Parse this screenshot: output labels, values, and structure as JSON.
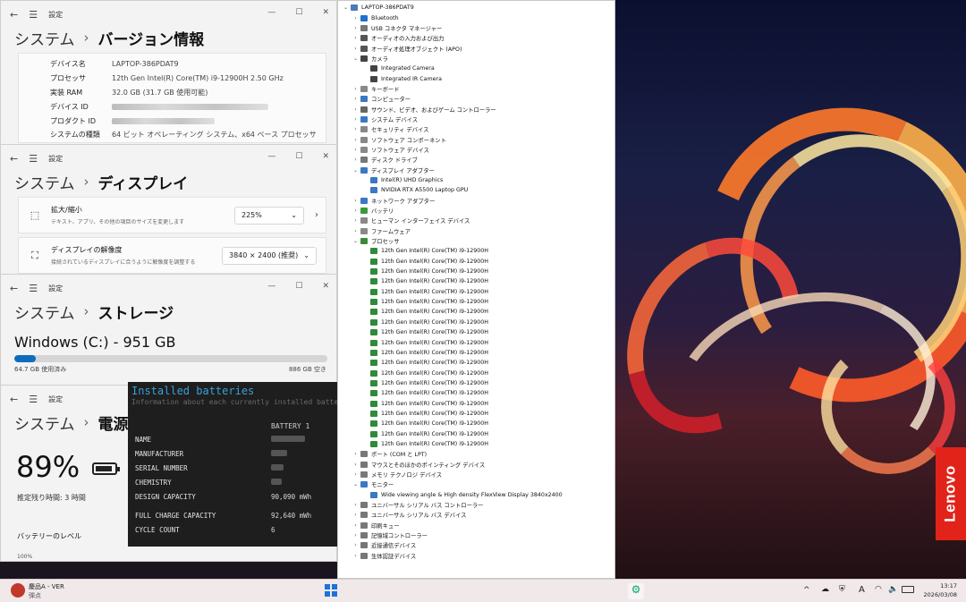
{
  "about": {
    "crumb1": "システム",
    "crumb2": "バージョン情報",
    "title": "設定",
    "rows": [
      {
        "k": "デバイス名",
        "v": "LAPTOP-386PDAT9"
      },
      {
        "k": "プロセッサ",
        "v": "12th Gen Intel(R) Core(TM) i9-12900H   2.50 GHz"
      },
      {
        "k": "実装 RAM",
        "v": "32.0 GB (31.7 GB 使用可能)"
      },
      {
        "k": "デバイス ID",
        "v": ""
      },
      {
        "k": "プロダクト ID",
        "v": ""
      },
      {
        "k": "システムの種類",
        "v": "64 ビット オペレーティング システム、x64 ベース プロセッサ"
      }
    ]
  },
  "display": {
    "crumb1": "システム",
    "crumb2": "ディスプレイ",
    "title": "設定",
    "scale_label": "拡大/縮小",
    "scale_desc": "テキスト、アプリ、その他の項目のサイズを変更します",
    "scale_value": "225%",
    "res_label": "ディスプレイの解像度",
    "res_desc": "接続されているディスプレイに合うように解像度を調整する",
    "res_value": "3840 × 2400 (推奨)"
  },
  "storage": {
    "crumb1": "システム",
    "crumb2": "ストレージ",
    "title": "設定",
    "drive": "Windows (C:) - 951 GB",
    "used": "64.7 GB 使用済み",
    "free": "886 GB 空き",
    "used_fraction": 0.068
  },
  "power": {
    "crumb1": "システム",
    "crumb2": "電源と",
    "title": "設定",
    "percent": "89%",
    "remaining": "推定残り時間: 3 時間",
    "level_label": "バッテリーのレベル",
    "axis_label": "100%"
  },
  "batteries": {
    "title": "Installed batteries",
    "subtitle": "Information about each currently installed battery",
    "column": "BATTERY 1",
    "rows": [
      {
        "k": "NAME",
        "v": ""
      },
      {
        "k": "MANUFACTURER",
        "v": ""
      },
      {
        "k": "SERIAL NUMBER",
        "v": ""
      },
      {
        "k": "CHEMISTRY",
        "v": ""
      },
      {
        "k": "DESIGN CAPACITY",
        "v": "90,090 mWh"
      },
      {
        "k": "FULL CHARGE CAPACITY",
        "v": "92,640 mWh"
      },
      {
        "k": "CYCLE COUNT",
        "v": "6"
      }
    ]
  },
  "devmgr": {
    "nodes": [
      {
        "t": "LAPTOP-386PDAT9",
        "l": 0,
        "e": "v",
        "c": "#4a7bb7"
      },
      {
        "t": "Bluetooth",
        "l": 1,
        "e": ">",
        "c": "#1f6fd1"
      },
      {
        "t": "USB コネクタ マネージャー",
        "l": 1,
        "e": ">",
        "c": "#777"
      },
      {
        "t": "オーディオの入力および出力",
        "l": 1,
        "e": ">",
        "c": "#555"
      },
      {
        "t": "オーディオ処理オブジェクト (APO)",
        "l": 1,
        "e": ">",
        "c": "#555"
      },
      {
        "t": "カメラ",
        "l": 1,
        "e": "v",
        "c": "#444"
      },
      {
        "t": "Integrated Camera",
        "l": 2,
        "e": "",
        "c": "#444"
      },
      {
        "t": "Integrated IR Camera",
        "l": 2,
        "e": "",
        "c": "#444"
      },
      {
        "t": "キーボード",
        "l": 1,
        "e": ">",
        "c": "#888"
      },
      {
        "t": "コンピューター",
        "l": 1,
        "e": ">",
        "c": "#3b78c4"
      },
      {
        "t": "サウンド、ビデオ、およびゲーム コントローラー",
        "l": 1,
        "e": ">",
        "c": "#666"
      },
      {
        "t": "システム デバイス",
        "l": 1,
        "e": ">",
        "c": "#3b78c4"
      },
      {
        "t": "セキュリティ デバイス",
        "l": 1,
        "e": ">",
        "c": "#888"
      },
      {
        "t": "ソフトウェア コンポーネント",
        "l": 1,
        "e": ">",
        "c": "#888"
      },
      {
        "t": "ソフトウェア デバイス",
        "l": 1,
        "e": ">",
        "c": "#888"
      },
      {
        "t": "ディスク ドライブ",
        "l": 1,
        "e": ">",
        "c": "#777"
      },
      {
        "t": "ディスプレイ アダプター",
        "l": 1,
        "e": "v",
        "c": "#3b78c4"
      },
      {
        "t": "Intel(R) UHD Graphics",
        "l": 2,
        "e": "",
        "c": "#3b78c4"
      },
      {
        "t": "NVIDIA RTX A5500 Laptop GPU",
        "l": 2,
        "e": "",
        "c": "#3b78c4"
      },
      {
        "t": "ネットワーク アダプター",
        "l": 1,
        "e": ">",
        "c": "#3b78c4"
      },
      {
        "t": "バッテリ",
        "l": 1,
        "e": ">",
        "c": "#3a9a3a"
      },
      {
        "t": "ヒューマン インターフェイス デバイス",
        "l": 1,
        "e": ">",
        "c": "#888"
      },
      {
        "t": "ファームウェア",
        "l": 1,
        "e": ">",
        "c": "#888"
      },
      {
        "t": "プロセッサ",
        "l": 1,
        "e": "v",
        "c": "#3a8a3a"
      },
      {
        "t": "12th Gen Intel(R) Core(TM) i9-12900H",
        "l": 2,
        "e": "",
        "c": "#2f8a3a"
      },
      {
        "t": "12th Gen Intel(R) Core(TM) i9-12900H",
        "l": 2,
        "e": "",
        "c": "#2f8a3a"
      },
      {
        "t": "12th Gen Intel(R) Core(TM) i9-12900H",
        "l": 2,
        "e": "",
        "c": "#2f8a3a"
      },
      {
        "t": "12th Gen Intel(R) Core(TM) i9-12900H",
        "l": 2,
        "e": "",
        "c": "#2f8a3a"
      },
      {
        "t": "12th Gen Intel(R) Core(TM) i9-12900H",
        "l": 2,
        "e": "",
        "c": "#2f8a3a"
      },
      {
        "t": "12th Gen Intel(R) Core(TM) i9-12900H",
        "l": 2,
        "e": "",
        "c": "#2f8a3a"
      },
      {
        "t": "12th Gen Intel(R) Core(TM) i9-12900H",
        "l": 2,
        "e": "",
        "c": "#2f8a3a"
      },
      {
        "t": "12th Gen Intel(R) Core(TM) i9-12900H",
        "l": 2,
        "e": "",
        "c": "#2f8a3a"
      },
      {
        "t": "12th Gen Intel(R) Core(TM) i9-12900H",
        "l": 2,
        "e": "",
        "c": "#2f8a3a"
      },
      {
        "t": "12th Gen Intel(R) Core(TM) i9-12900H",
        "l": 2,
        "e": "",
        "c": "#2f8a3a"
      },
      {
        "t": "12th Gen Intel(R) Core(TM) i9-12900H",
        "l": 2,
        "e": "",
        "c": "#2f8a3a"
      },
      {
        "t": "12th Gen Intel(R) Core(TM) i9-12900H",
        "l": 2,
        "e": "",
        "c": "#2f8a3a"
      },
      {
        "t": "12th Gen Intel(R) Core(TM) i9-12900H",
        "l": 2,
        "e": "",
        "c": "#2f8a3a"
      },
      {
        "t": "12th Gen Intel(R) Core(TM) i9-12900H",
        "l": 2,
        "e": "",
        "c": "#2f8a3a"
      },
      {
        "t": "12th Gen Intel(R) Core(TM) i9-12900H",
        "l": 2,
        "e": "",
        "c": "#2f8a3a"
      },
      {
        "t": "12th Gen Intel(R) Core(TM) i9-12900H",
        "l": 2,
        "e": "",
        "c": "#2f8a3a"
      },
      {
        "t": "12th Gen Intel(R) Core(TM) i9-12900H",
        "l": 2,
        "e": "",
        "c": "#2f8a3a"
      },
      {
        "t": "12th Gen Intel(R) Core(TM) i9-12900H",
        "l": 2,
        "e": "",
        "c": "#2f8a3a"
      },
      {
        "t": "12th Gen Intel(R) Core(TM) i9-12900H",
        "l": 2,
        "e": "",
        "c": "#2f8a3a"
      },
      {
        "t": "12th Gen Intel(R) Core(TM) i9-12900H",
        "l": 2,
        "e": "",
        "c": "#2f8a3a"
      },
      {
        "t": "ポート (COM と LPT)",
        "l": 1,
        "e": ">",
        "c": "#777"
      },
      {
        "t": "マウスとそのほかのポインティング デバイス",
        "l": 1,
        "e": ">",
        "c": "#777"
      },
      {
        "t": "メモリ テクノロジ デバイス",
        "l": 1,
        "e": ">",
        "c": "#777"
      },
      {
        "t": "モニター",
        "l": 1,
        "e": "v",
        "c": "#3b78c4"
      },
      {
        "t": "Wide viewing angle & High density FlexView Display 3840x2400",
        "l": 2,
        "e": "",
        "c": "#3b78c4"
      },
      {
        "t": "ユニバーサル シリアル バス コントローラー",
        "l": 1,
        "e": ">",
        "c": "#777"
      },
      {
        "t": "ユニバーサル シリアル バス デバイス",
        "l": 1,
        "e": ">",
        "c": "#777"
      },
      {
        "t": "印刷キュー",
        "l": 1,
        "e": ">",
        "c": "#777"
      },
      {
        "t": "記憶域コントローラー",
        "l": 1,
        "e": ">",
        "c": "#777"
      },
      {
        "t": "近接通信デバイス",
        "l": 1,
        "e": ">",
        "c": "#777"
      },
      {
        "t": "生体認証デバイス",
        "l": 1,
        "e": ">",
        "c": "#777"
      }
    ]
  },
  "taskbar": {
    "app_name": "慶品A - VER",
    "app_sub": "弾点",
    "time": "13:17",
    "date": "2026/03/08",
    "ime": "A"
  },
  "brand": {
    "logo": "Lenovo",
    "color": "#e2231a"
  }
}
